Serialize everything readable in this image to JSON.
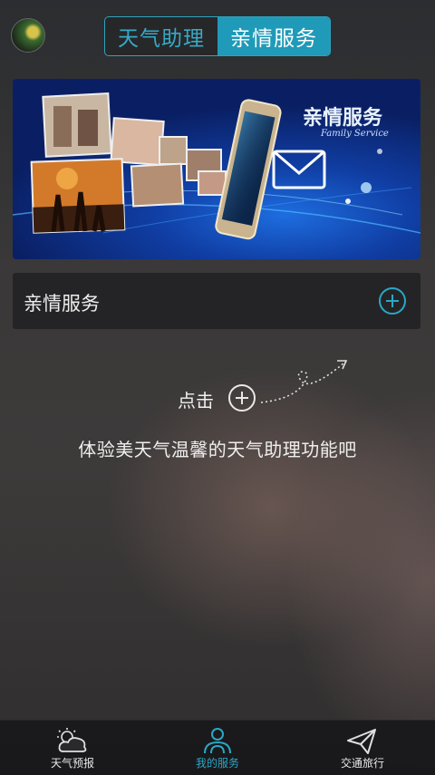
{
  "header": {
    "tabs": [
      {
        "label": "天气助理",
        "active": false
      },
      {
        "label": "亲情服务",
        "active": true
      }
    ],
    "avatar_icon": "user-avatar"
  },
  "banner": {
    "title": "亲情服务",
    "subtitle": "Family Service",
    "icon": "envelope-icon"
  },
  "service": {
    "label": "亲情服务",
    "add_icon": "plus-circle-icon"
  },
  "hint": {
    "prefix": "点击",
    "icon": "plus-circle-icon",
    "description": "体验美天气温馨的天气助理功能吧"
  },
  "tabbar": {
    "items": [
      {
        "label": "天气预报",
        "icon": "cloud-sun-icon",
        "active": false
      },
      {
        "label": "我的服务",
        "icon": "users-icon",
        "active": true
      },
      {
        "label": "交通旅行",
        "icon": "paper-plane-icon",
        "active": false
      }
    ]
  },
  "colors": {
    "accent": "#2aa7c7",
    "active_tab_bg": "#1f9ab8",
    "background": "#3a3838"
  }
}
